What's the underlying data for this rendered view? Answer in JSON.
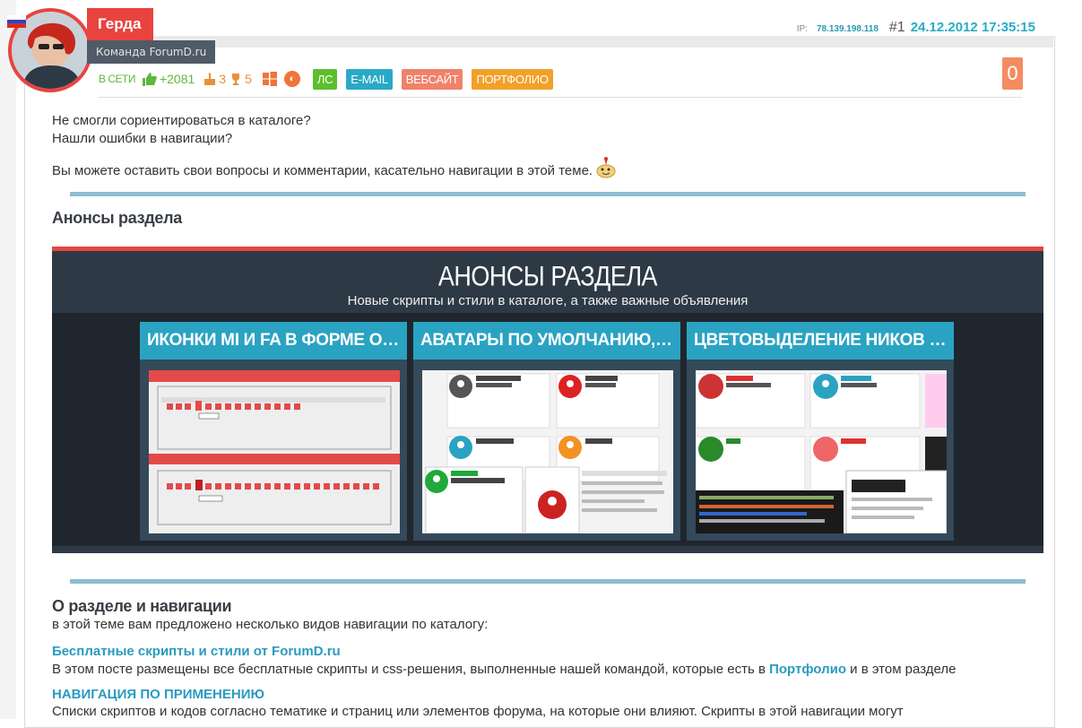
{
  "user": {
    "name": "Герда",
    "team": "Команда ForumD.ru",
    "online": "В СЕТИ",
    "reputation": "+2081",
    "cake_count": "3",
    "trophy_count": "5"
  },
  "post_meta": {
    "ip_label": "IP:",
    "ip": "78.139.198.118",
    "number": "#1",
    "datetime": "24.12.2012 17:35:15"
  },
  "buttons": {
    "pm": "ЛС",
    "email": "E-MAIL",
    "website": "ВЕБСАЙТ",
    "portfolio": "ПОРТФОЛИО"
  },
  "vote_count": "0",
  "intro": {
    "line1": "Не смогли сориентироваться в каталоге?",
    "line2": "Нашли ошибки в навигации?",
    "line3": "Вы можете оставить свои вопросы и комментарии, касательно навигации в этой теме."
  },
  "announcements_heading": "Анонсы раздела",
  "banner": {
    "title": "АНОНСЫ РАЗДЕЛА",
    "subtitle": "Новые скрипты и стили в каталоге, а также важные объявления",
    "cards": [
      {
        "title": "ИКОНКИ MI И FA В ФОРМЕ ОТВЕТА"
      },
      {
        "title": "АВАТАРЫ ПО УМОЛЧАНИЮ, РАЗНЫЕ А..."
      },
      {
        "title": "ЦВЕТОВЫДЕЛЕНИЕ НИКОВ И ПРОФИЛ..."
      }
    ]
  },
  "about": {
    "heading": "О разделе и навигации",
    "intro": "в этой теме вам предложено несколько видов навигации по каталогу:",
    "link1": "Бесплатные скрипты и стили от ForumD.ru",
    "desc1_a": "В этом посте размещены все бесплатные скрипты и css-решения, выполненные нашей командой, которые есть в ",
    "desc1_link": "Портфолио",
    "desc1_b": " и в этом разделе",
    "link2": "НАВИГАЦИЯ ПО ПРИМЕНЕНИЮ",
    "desc2": "Списки скриптов и кодов согласно тематике и страниц или элементов форума, на которые они влияют. Скрипты в этой навигации могут"
  },
  "colors": {
    "accent_red": "#e8433f",
    "accent_blue": "#2aa3c2",
    "green": "#5fb83a",
    "orange": "#f38d61"
  }
}
